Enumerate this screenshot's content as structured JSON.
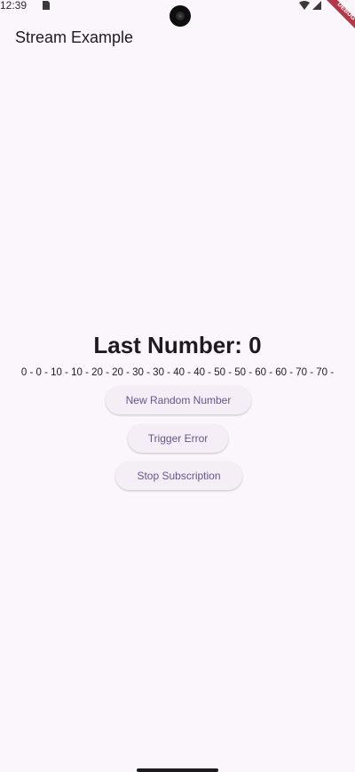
{
  "status_bar": {
    "time": "12:39",
    "sim_icon": "sim-card-icon",
    "wifi_icon": "wifi-icon",
    "signal_icon": "signal-icon"
  },
  "debug_banner": {
    "label": "DEBUG",
    "color": "#b3394a"
  },
  "app_bar": {
    "title": "Stream Example"
  },
  "main": {
    "last_number": "Last Number: 0",
    "history": "0 - 0 - 10 - 10 - 20 - 20 - 30 - 30 - 40 - 40 - 50 - 50 - 60 - 60 - 70 - 70 -"
  },
  "buttons": {
    "new_random": "New Random Number",
    "trigger_error": "Trigger Error",
    "stop_subscription": "Stop Subscription"
  },
  "colors": {
    "background": "#fbf6fb",
    "accent": "#65558f",
    "button_bg": "#f6eef6",
    "text": "#1d1b20"
  }
}
